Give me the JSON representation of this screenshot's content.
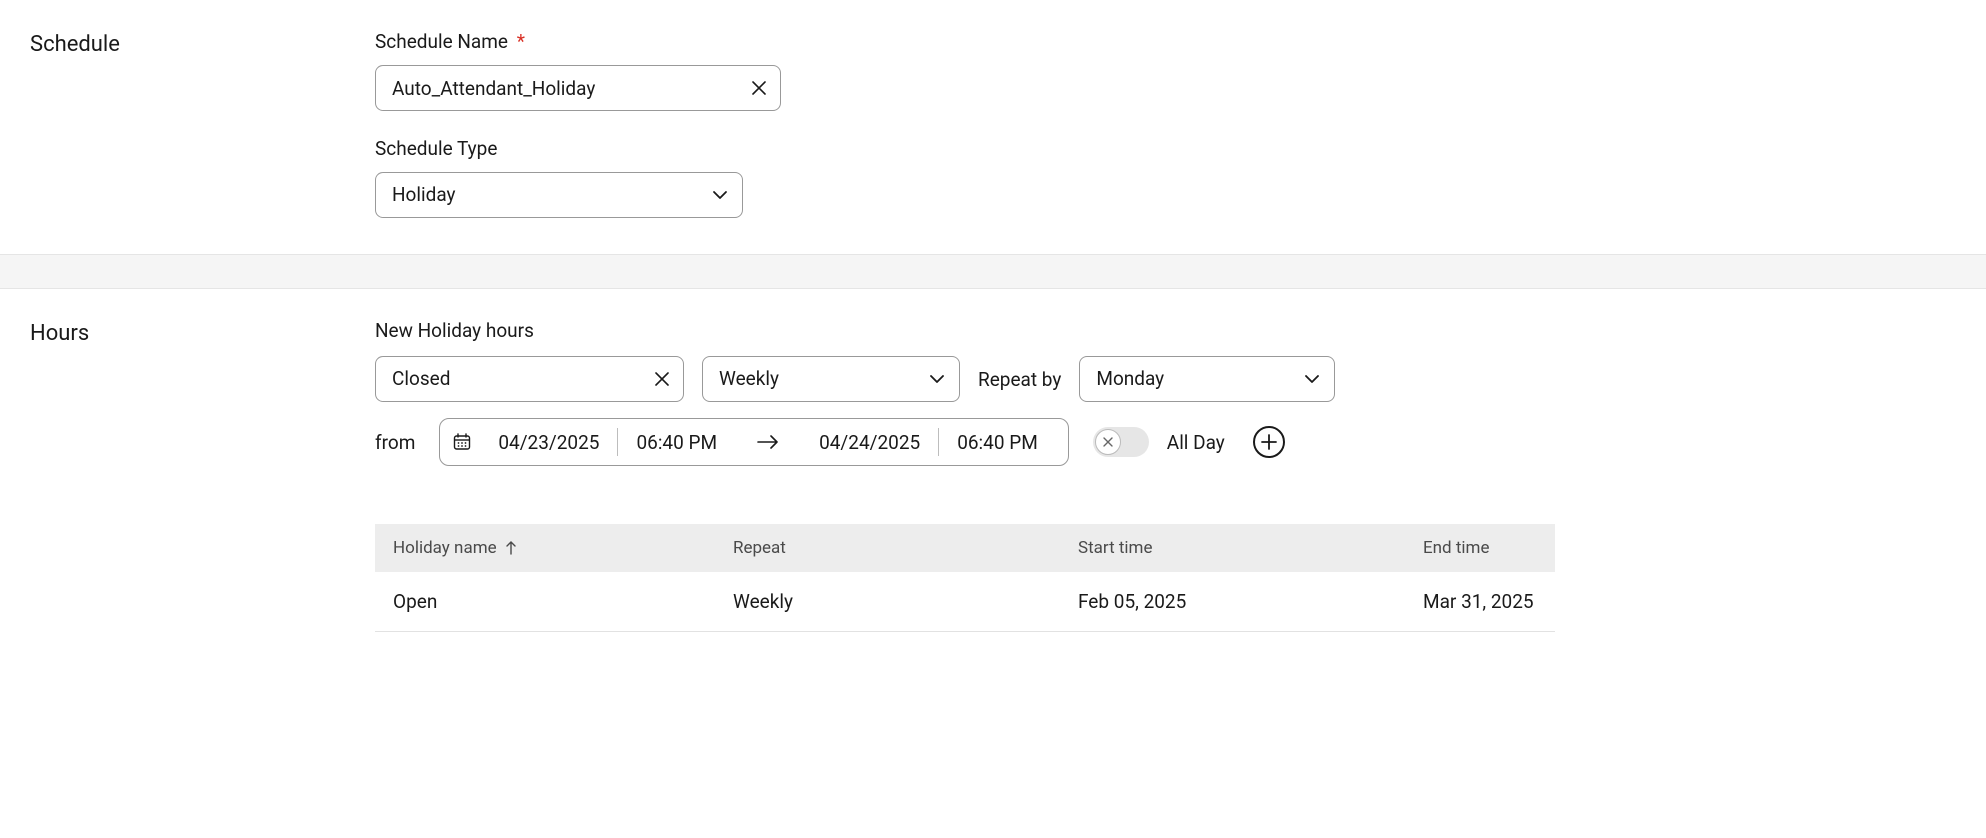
{
  "schedule": {
    "section_label": "Schedule",
    "name_label": "Schedule Name",
    "name_value": "Auto_Attendant_Holiday",
    "type_label": "Schedule Type",
    "type_value": "Holiday"
  },
  "hours": {
    "section_label": "Hours",
    "new_hours_label": "New Holiday hours",
    "status_value": "Closed",
    "frequency_value": "Weekly",
    "repeat_by_label": "Repeat by",
    "repeat_by_value": "Monday",
    "from_label": "from",
    "from_date": "04/23/2025",
    "from_time": "06:40 PM",
    "to_date": "04/24/2025",
    "to_time": "06:40 PM",
    "all_day_label": "All Day"
  },
  "table": {
    "headers": {
      "name": "Holiday name",
      "repeat": "Repeat",
      "start": "Start time",
      "end": "End time"
    },
    "rows": [
      {
        "name": "Open",
        "repeat": "Weekly",
        "start": "Feb 05, 2025",
        "end": "Mar 31, 2025"
      }
    ]
  }
}
